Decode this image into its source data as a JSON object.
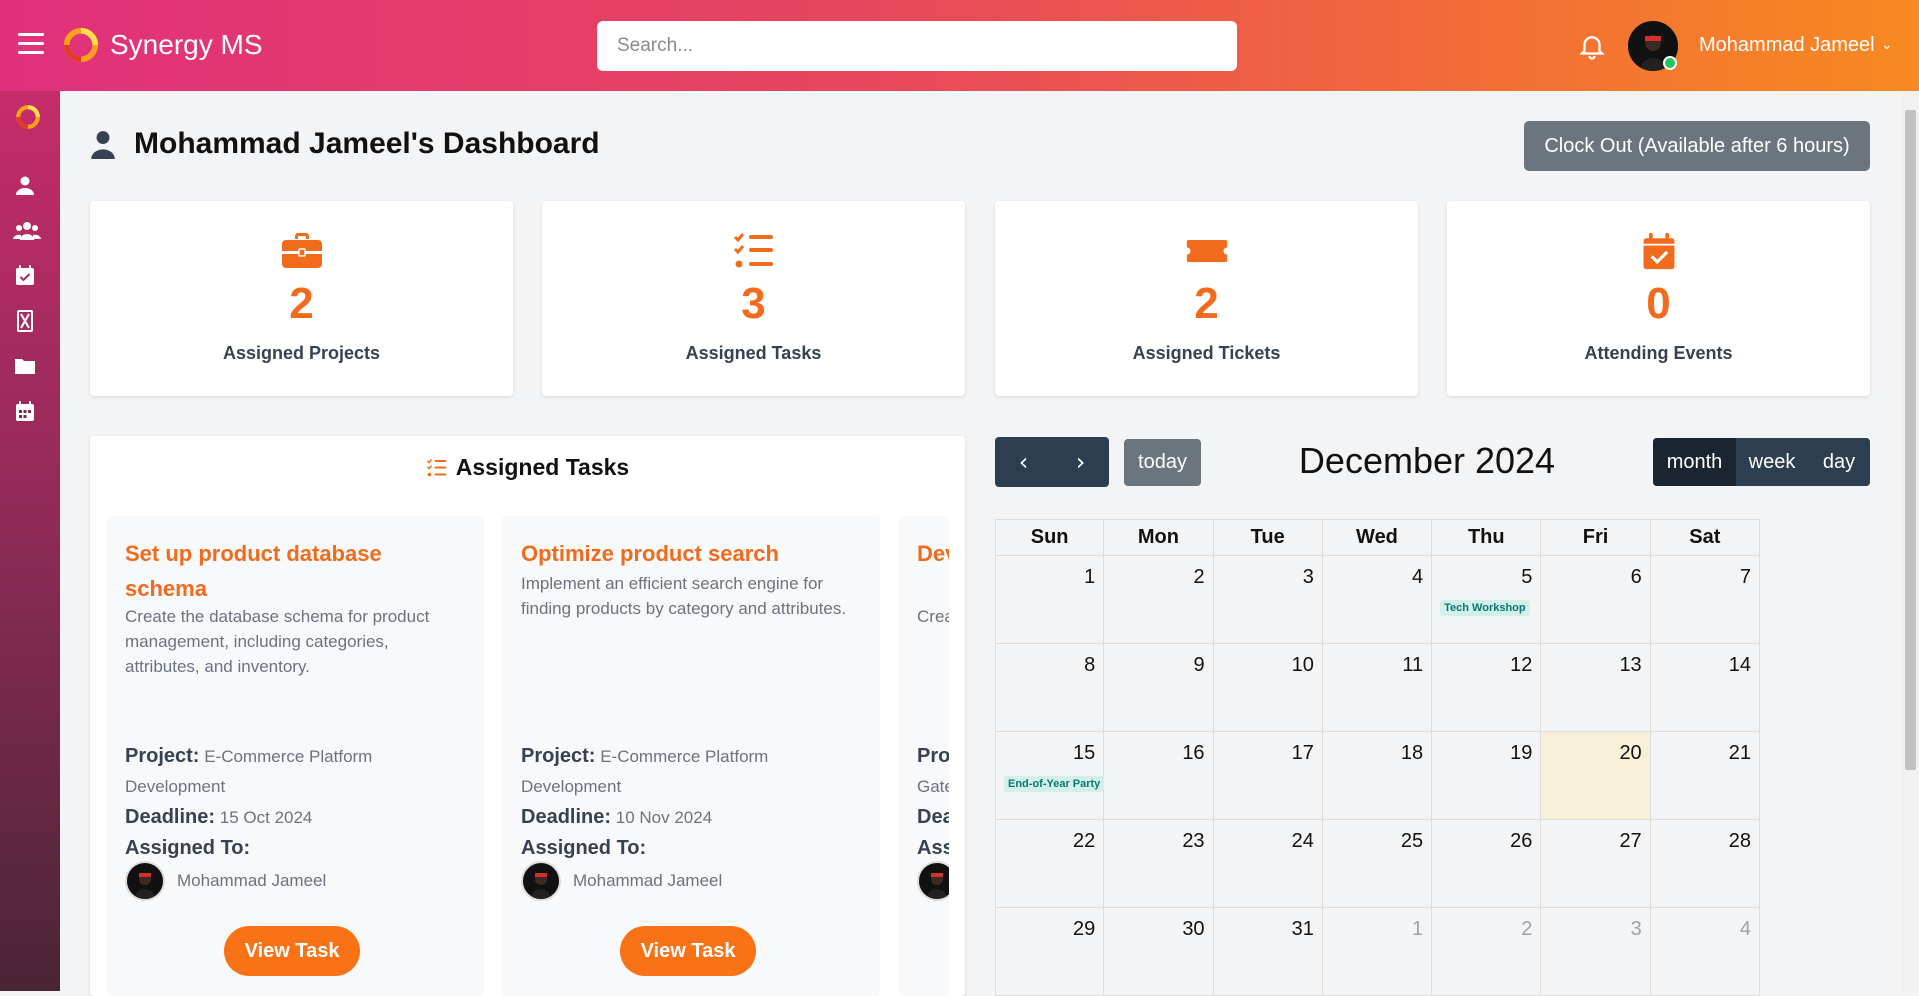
{
  "app": {
    "name": "Synergy MS"
  },
  "search": {
    "placeholder": "Search..."
  },
  "user": {
    "name": "Mohammad Jameel"
  },
  "colors": {
    "accent": "#f26b1d",
    "header_gradient": [
      "#e0307c",
      "#f78a20"
    ],
    "calendar_nav": "#2c3e50",
    "today_bg": "#f6f0d8",
    "event_bg": "#d1f0ea"
  },
  "sidebar": {
    "items": [
      {
        "icon": "logo-icon"
      },
      {
        "icon": "user-icon"
      },
      {
        "icon": "users-icon"
      },
      {
        "icon": "calendar-check-icon"
      },
      {
        "icon": "hourglass-icon"
      },
      {
        "icon": "folder-icon"
      },
      {
        "icon": "calendar-icon"
      }
    ]
  },
  "dashboard": {
    "title": "Mohammad Jameel's Dashboard",
    "clock_out": "Clock Out (Available after 6 hours)"
  },
  "stats": [
    {
      "icon": "briefcase-icon",
      "value": "2",
      "label": "Assigned Projects"
    },
    {
      "icon": "tasks-list-icon",
      "value": "3",
      "label": "Assigned Tasks"
    },
    {
      "icon": "ticket-icon",
      "value": "2",
      "label": "Assigned Tickets"
    },
    {
      "icon": "calendar-check-icon",
      "value": "0",
      "label": "Attending Events"
    }
  ],
  "tasks_panel": {
    "title": "Assigned Tasks",
    "project_label": "Project:",
    "deadline_label": "Deadline:",
    "assigned_label": "Assigned To:",
    "button_label": "View Task",
    "tasks": [
      {
        "title": "Set up product database schema",
        "description": "Create the database schema for product management, including categories, attributes, and inventory.",
        "project": "E-Commerce Platform Development",
        "deadline": "15 Oct 2024",
        "assignee": "Mohammad Jameel"
      },
      {
        "title": "Optimize product search",
        "description": "Implement an efficient search engine for finding products by category and attributes.",
        "project": "E-Commerce Platform Development",
        "deadline": "10 Nov 2024",
        "assignee": "Mohammad Jameel"
      },
      {
        "title": "Dev gat",
        "description": "Crea integ",
        "project": "Gate",
        "deadline": "",
        "assignee": ""
      }
    ]
  },
  "calendar": {
    "title": "December 2024",
    "today_label": "today",
    "prev": "‹",
    "next": "›",
    "views": [
      "month",
      "week",
      "day"
    ],
    "active_view": "month",
    "weekdays": [
      "Sun",
      "Mon",
      "Tue",
      "Wed",
      "Thu",
      "Fri",
      "Sat"
    ],
    "weeks": [
      [
        {
          "d": "1"
        },
        {
          "d": "2"
        },
        {
          "d": "3"
        },
        {
          "d": "4"
        },
        {
          "d": "5",
          "event": "Tech Workshop"
        },
        {
          "d": "6"
        },
        {
          "d": "7"
        }
      ],
      [
        {
          "d": "8"
        },
        {
          "d": "9"
        },
        {
          "d": "10"
        },
        {
          "d": "11"
        },
        {
          "d": "12"
        },
        {
          "d": "13"
        },
        {
          "d": "14"
        }
      ],
      [
        {
          "d": "15",
          "event": "End-of-Year Party"
        },
        {
          "d": "16"
        },
        {
          "d": "17"
        },
        {
          "d": "18"
        },
        {
          "d": "19"
        },
        {
          "d": "20",
          "today": true
        },
        {
          "d": "21"
        }
      ],
      [
        {
          "d": "22"
        },
        {
          "d": "23"
        },
        {
          "d": "24"
        },
        {
          "d": "25"
        },
        {
          "d": "26"
        },
        {
          "d": "27"
        },
        {
          "d": "28"
        }
      ],
      [
        {
          "d": "29"
        },
        {
          "d": "30"
        },
        {
          "d": "31"
        },
        {
          "d": "1",
          "other": true
        },
        {
          "d": "2",
          "other": true
        },
        {
          "d": "3",
          "other": true
        },
        {
          "d": "4",
          "other": true
        }
      ]
    ]
  }
}
